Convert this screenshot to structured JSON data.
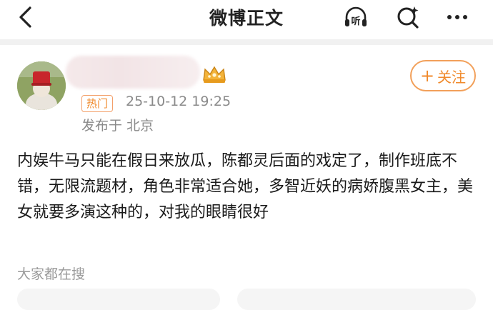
{
  "header": {
    "title": "微博正文",
    "icons": [
      "back-arrow-icon",
      "listen-icon",
      "search-icon",
      "more-icon"
    ],
    "listen_glyph": "听"
  },
  "post": {
    "follow_label": "关注",
    "hot_tag": "热门",
    "timestamp": "25-10-12 19:25",
    "location": "发布于 北京",
    "content": "内娱牛马只能在假日来放瓜，陈都灵后面的戏定了，制作班底不错，无限流题材，角色非常适合她，多智近妖的病娇腹黑女主，美女就要多演这种的，对我的眼睛很好"
  },
  "related": {
    "label": "大家都在搜"
  },
  "colors": {
    "accent": "#f08a2c",
    "secondary_text": "#8a8a8a"
  }
}
